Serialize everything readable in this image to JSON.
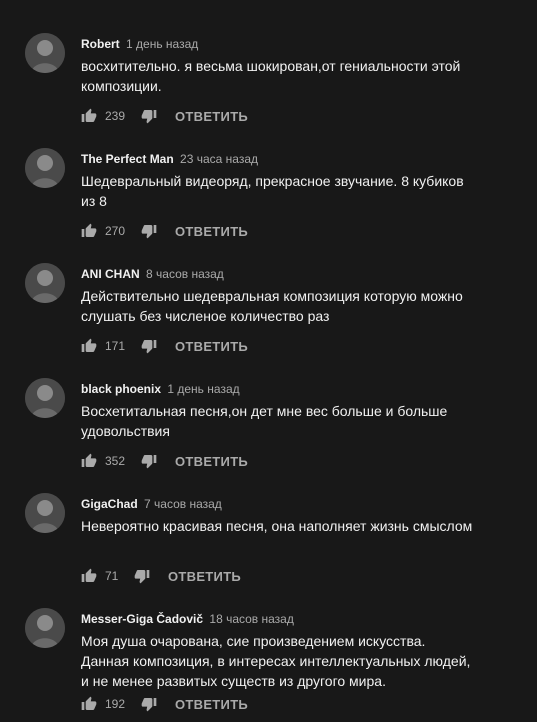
{
  "colors": {
    "background": "#181818",
    "text_primary": "#f1f1f1",
    "text_secondary": "#aaaaaa"
  },
  "comments": [
    {
      "author": "Robert",
      "time": "1 день назад",
      "text": "восхитительно. я весьма шокирован,от гениальности этой композиции.",
      "likes": "239",
      "reply": "ОТВЕТИТЬ",
      "avatar": "avatar-icon"
    },
    {
      "author": "The Perfect Man",
      "time": "23 часа назад",
      "text": "Шедевральный видеоряд, прекрасное звучание. 8 кубиков из 8",
      "likes": "270",
      "reply": "ОТВЕТИТЬ",
      "avatar": "avatar-icon"
    },
    {
      "author": "ANI CHAN",
      "time": "8 часов назад",
      "text": "Действительно шедевральная композиция которую можно слушать без численое количество раз",
      "likes": "171",
      "reply": "ОТВЕТИТЬ",
      "avatar": "avatar-icon"
    },
    {
      "author": "black phoenix",
      "time": "1 день назад",
      "text": "Восхетитальная песня,он дет мне вес больше и больше удовольствия",
      "likes": "352",
      "reply": "ОТВЕТИТЬ",
      "avatar": "avatar-icon"
    },
    {
      "author": "GigaChad",
      "time": "7 часов назад",
      "text": "Невероятно красивая песня, она наполняет жизнь смыслом",
      "likes": "71",
      "reply": "ОТВЕТИТЬ",
      "avatar": "avatar-icon"
    },
    {
      "author": "Messer-Giga Čadovič",
      "time": "18 часов назад",
      "text": "Моя душа очарована, сие произведением искусства. Данная композиция, в интересах  интеллектуальных людей, и не менее развитых существ из другого мира.",
      "likes": "192",
      "reply": "ОТВЕТИТЬ",
      "avatar": "avatar-icon"
    }
  ]
}
